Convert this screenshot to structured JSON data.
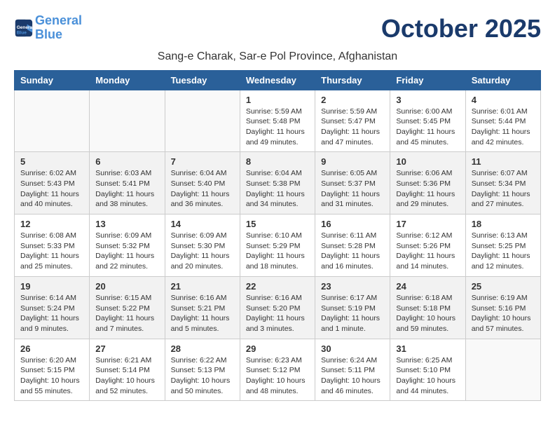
{
  "logo": {
    "line1": "General",
    "line2": "Blue"
  },
  "title": "October 2025",
  "location": "Sang-e Charak, Sar-e Pol Province, Afghanistan",
  "weekdays": [
    "Sunday",
    "Monday",
    "Tuesday",
    "Wednesday",
    "Thursday",
    "Friday",
    "Saturday"
  ],
  "weeks": [
    [
      {
        "day": "",
        "info": ""
      },
      {
        "day": "",
        "info": ""
      },
      {
        "day": "",
        "info": ""
      },
      {
        "day": "1",
        "info": "Sunrise: 5:59 AM\nSunset: 5:48 PM\nDaylight: 11 hours\nand 49 minutes."
      },
      {
        "day": "2",
        "info": "Sunrise: 5:59 AM\nSunset: 5:47 PM\nDaylight: 11 hours\nand 47 minutes."
      },
      {
        "day": "3",
        "info": "Sunrise: 6:00 AM\nSunset: 5:45 PM\nDaylight: 11 hours\nand 45 minutes."
      },
      {
        "day": "4",
        "info": "Sunrise: 6:01 AM\nSunset: 5:44 PM\nDaylight: 11 hours\nand 42 minutes."
      }
    ],
    [
      {
        "day": "5",
        "info": "Sunrise: 6:02 AM\nSunset: 5:43 PM\nDaylight: 11 hours\nand 40 minutes."
      },
      {
        "day": "6",
        "info": "Sunrise: 6:03 AM\nSunset: 5:41 PM\nDaylight: 11 hours\nand 38 minutes."
      },
      {
        "day": "7",
        "info": "Sunrise: 6:04 AM\nSunset: 5:40 PM\nDaylight: 11 hours\nand 36 minutes."
      },
      {
        "day": "8",
        "info": "Sunrise: 6:04 AM\nSunset: 5:38 PM\nDaylight: 11 hours\nand 34 minutes."
      },
      {
        "day": "9",
        "info": "Sunrise: 6:05 AM\nSunset: 5:37 PM\nDaylight: 11 hours\nand 31 minutes."
      },
      {
        "day": "10",
        "info": "Sunrise: 6:06 AM\nSunset: 5:36 PM\nDaylight: 11 hours\nand 29 minutes."
      },
      {
        "day": "11",
        "info": "Sunrise: 6:07 AM\nSunset: 5:34 PM\nDaylight: 11 hours\nand 27 minutes."
      }
    ],
    [
      {
        "day": "12",
        "info": "Sunrise: 6:08 AM\nSunset: 5:33 PM\nDaylight: 11 hours\nand 25 minutes."
      },
      {
        "day": "13",
        "info": "Sunrise: 6:09 AM\nSunset: 5:32 PM\nDaylight: 11 hours\nand 22 minutes."
      },
      {
        "day": "14",
        "info": "Sunrise: 6:09 AM\nSunset: 5:30 PM\nDaylight: 11 hours\nand 20 minutes."
      },
      {
        "day": "15",
        "info": "Sunrise: 6:10 AM\nSunset: 5:29 PM\nDaylight: 11 hours\nand 18 minutes."
      },
      {
        "day": "16",
        "info": "Sunrise: 6:11 AM\nSunset: 5:28 PM\nDaylight: 11 hours\nand 16 minutes."
      },
      {
        "day": "17",
        "info": "Sunrise: 6:12 AM\nSunset: 5:26 PM\nDaylight: 11 hours\nand 14 minutes."
      },
      {
        "day": "18",
        "info": "Sunrise: 6:13 AM\nSunset: 5:25 PM\nDaylight: 11 hours\nand 12 minutes."
      }
    ],
    [
      {
        "day": "19",
        "info": "Sunrise: 6:14 AM\nSunset: 5:24 PM\nDaylight: 11 hours\nand 9 minutes."
      },
      {
        "day": "20",
        "info": "Sunrise: 6:15 AM\nSunset: 5:22 PM\nDaylight: 11 hours\nand 7 minutes."
      },
      {
        "day": "21",
        "info": "Sunrise: 6:16 AM\nSunset: 5:21 PM\nDaylight: 11 hours\nand 5 minutes."
      },
      {
        "day": "22",
        "info": "Sunrise: 6:16 AM\nSunset: 5:20 PM\nDaylight: 11 hours\nand 3 minutes."
      },
      {
        "day": "23",
        "info": "Sunrise: 6:17 AM\nSunset: 5:19 PM\nDaylight: 11 hours\nand 1 minute."
      },
      {
        "day": "24",
        "info": "Sunrise: 6:18 AM\nSunset: 5:18 PM\nDaylight: 10 hours\nand 59 minutes."
      },
      {
        "day": "25",
        "info": "Sunrise: 6:19 AM\nSunset: 5:16 PM\nDaylight: 10 hours\nand 57 minutes."
      }
    ],
    [
      {
        "day": "26",
        "info": "Sunrise: 6:20 AM\nSunset: 5:15 PM\nDaylight: 10 hours\nand 55 minutes."
      },
      {
        "day": "27",
        "info": "Sunrise: 6:21 AM\nSunset: 5:14 PM\nDaylight: 10 hours\nand 52 minutes."
      },
      {
        "day": "28",
        "info": "Sunrise: 6:22 AM\nSunset: 5:13 PM\nDaylight: 10 hours\nand 50 minutes."
      },
      {
        "day": "29",
        "info": "Sunrise: 6:23 AM\nSunset: 5:12 PM\nDaylight: 10 hours\nand 48 minutes."
      },
      {
        "day": "30",
        "info": "Sunrise: 6:24 AM\nSunset: 5:11 PM\nDaylight: 10 hours\nand 46 minutes."
      },
      {
        "day": "31",
        "info": "Sunrise: 6:25 AM\nSunset: 5:10 PM\nDaylight: 10 hours\nand 44 minutes."
      },
      {
        "day": "",
        "info": ""
      }
    ]
  ]
}
